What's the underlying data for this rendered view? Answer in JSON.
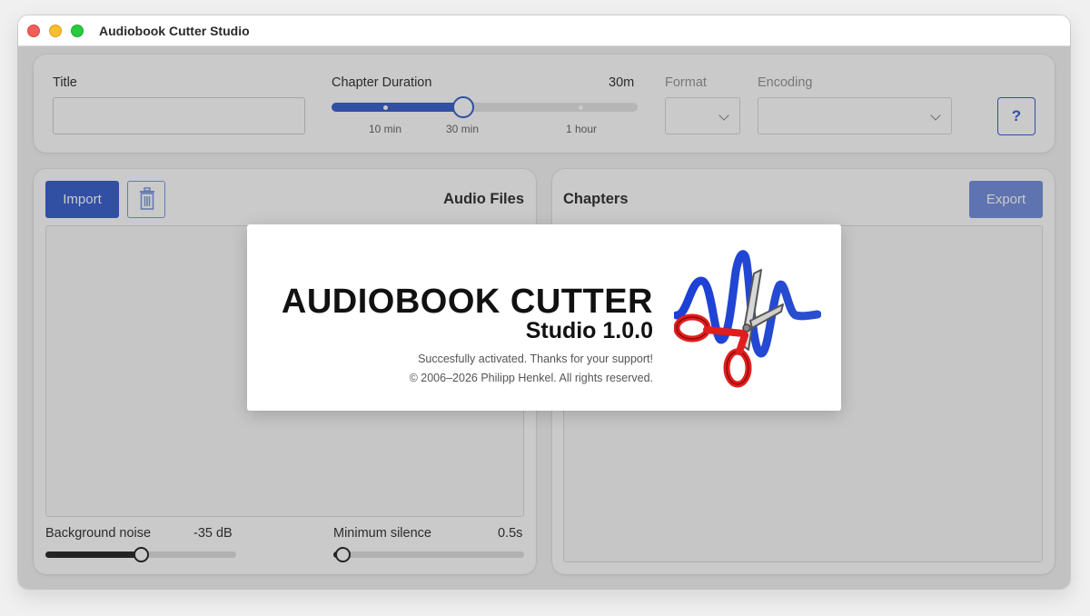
{
  "window": {
    "title": "Audiobook Cutter Studio"
  },
  "top_bar": {
    "title_label": "Title",
    "title_value": "",
    "chapter_duration_label": "Chapter Duration",
    "chapter_duration_value": "30m",
    "chapter_duration_ticks": [
      "10 min",
      "30 min",
      "1 hour"
    ],
    "chapter_duration_position": 0.43,
    "format_label": "Format",
    "format_value": "",
    "encoding_label": "Encoding",
    "encoding_value": "",
    "help_label": "?"
  },
  "audio_files": {
    "import_label": "Import",
    "title": "Audio Files",
    "background_noise_label": "Background noise",
    "background_noise_value": "-35 dB",
    "background_noise_position": 0.5,
    "minimum_silence_label": "Minimum silence",
    "minimum_silence_value": "0.5s",
    "minimum_silence_position": 0.05
  },
  "chapters": {
    "title": "Chapters",
    "export_label": "Export"
  },
  "splash": {
    "title": "AUDIOBOOK CUTTER",
    "subtitle": "Studio 1.0.0",
    "status": "Succesfully activated. Thanks for your support!",
    "copyright": "© 2006–2026 Philipp Henkel. All rights reserved."
  },
  "colors": {
    "accent": "#2450c8",
    "close": "#ee5f58",
    "minimize": "#f8be2e",
    "maximize": "#29c940"
  },
  "icons": {
    "delete": "trash-icon",
    "select_arrow": "chevron-down-icon",
    "logo": "scissors-waveform-logo"
  }
}
